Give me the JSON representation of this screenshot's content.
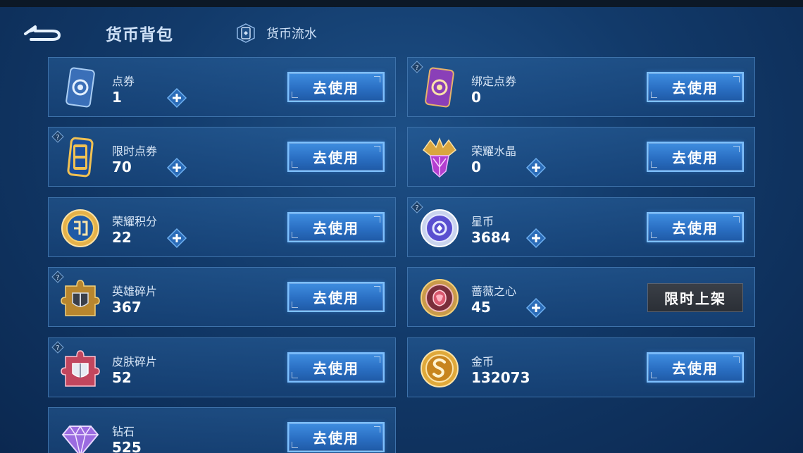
{
  "header": {
    "title": "货币背包",
    "flow_tab": "货币流水"
  },
  "buttons": {
    "use": "去使用",
    "limited": "限时上架"
  },
  "colors": {
    "accent": "#2a6fc3",
    "button_border": "#7dc0ff",
    "card_border": "#3e72aa",
    "background": "#123a6a"
  },
  "currencies": {
    "c0": {
      "name": "点券",
      "value": "1",
      "icon": "voucher-card-icon",
      "has_plus": true,
      "has_help": false
    },
    "c1": {
      "name": "绑定点券",
      "value": "0",
      "icon": "bound-voucher-card-icon",
      "has_plus": false,
      "has_help": true
    },
    "c2": {
      "name": "限时点券",
      "value": "70",
      "icon": "limited-voucher-icon",
      "has_plus": true,
      "has_help": true
    },
    "c3": {
      "name": "荣耀水晶",
      "value": "0",
      "icon": "glory-crystal-icon",
      "has_plus": true,
      "has_help": false
    },
    "c4": {
      "name": "荣耀积分",
      "value": "22",
      "icon": "glory-points-icon",
      "has_plus": true,
      "has_help": false
    },
    "c5": {
      "name": "星币",
      "value": "3684",
      "icon": "star-coin-icon",
      "has_plus": true,
      "has_help": true
    },
    "c6": {
      "name": "英雄碎片",
      "value": "367",
      "icon": "hero-fragment-icon",
      "has_plus": false,
      "has_help": true
    },
    "c7": {
      "name": "蔷薇之心",
      "value": "45",
      "icon": "rose-heart-icon",
      "has_plus": true,
      "has_help": false
    },
    "c8": {
      "name": "皮肤碎片",
      "value": "52",
      "icon": "skin-fragment-icon",
      "has_plus": false,
      "has_help": true
    },
    "c9": {
      "name": "金币",
      "value": "132073",
      "icon": "gold-coin-icon",
      "has_plus": false,
      "has_help": false
    },
    "c10": {
      "name": "钻石",
      "value": "525",
      "icon": "diamond-icon",
      "has_plus": false,
      "has_help": false
    }
  }
}
